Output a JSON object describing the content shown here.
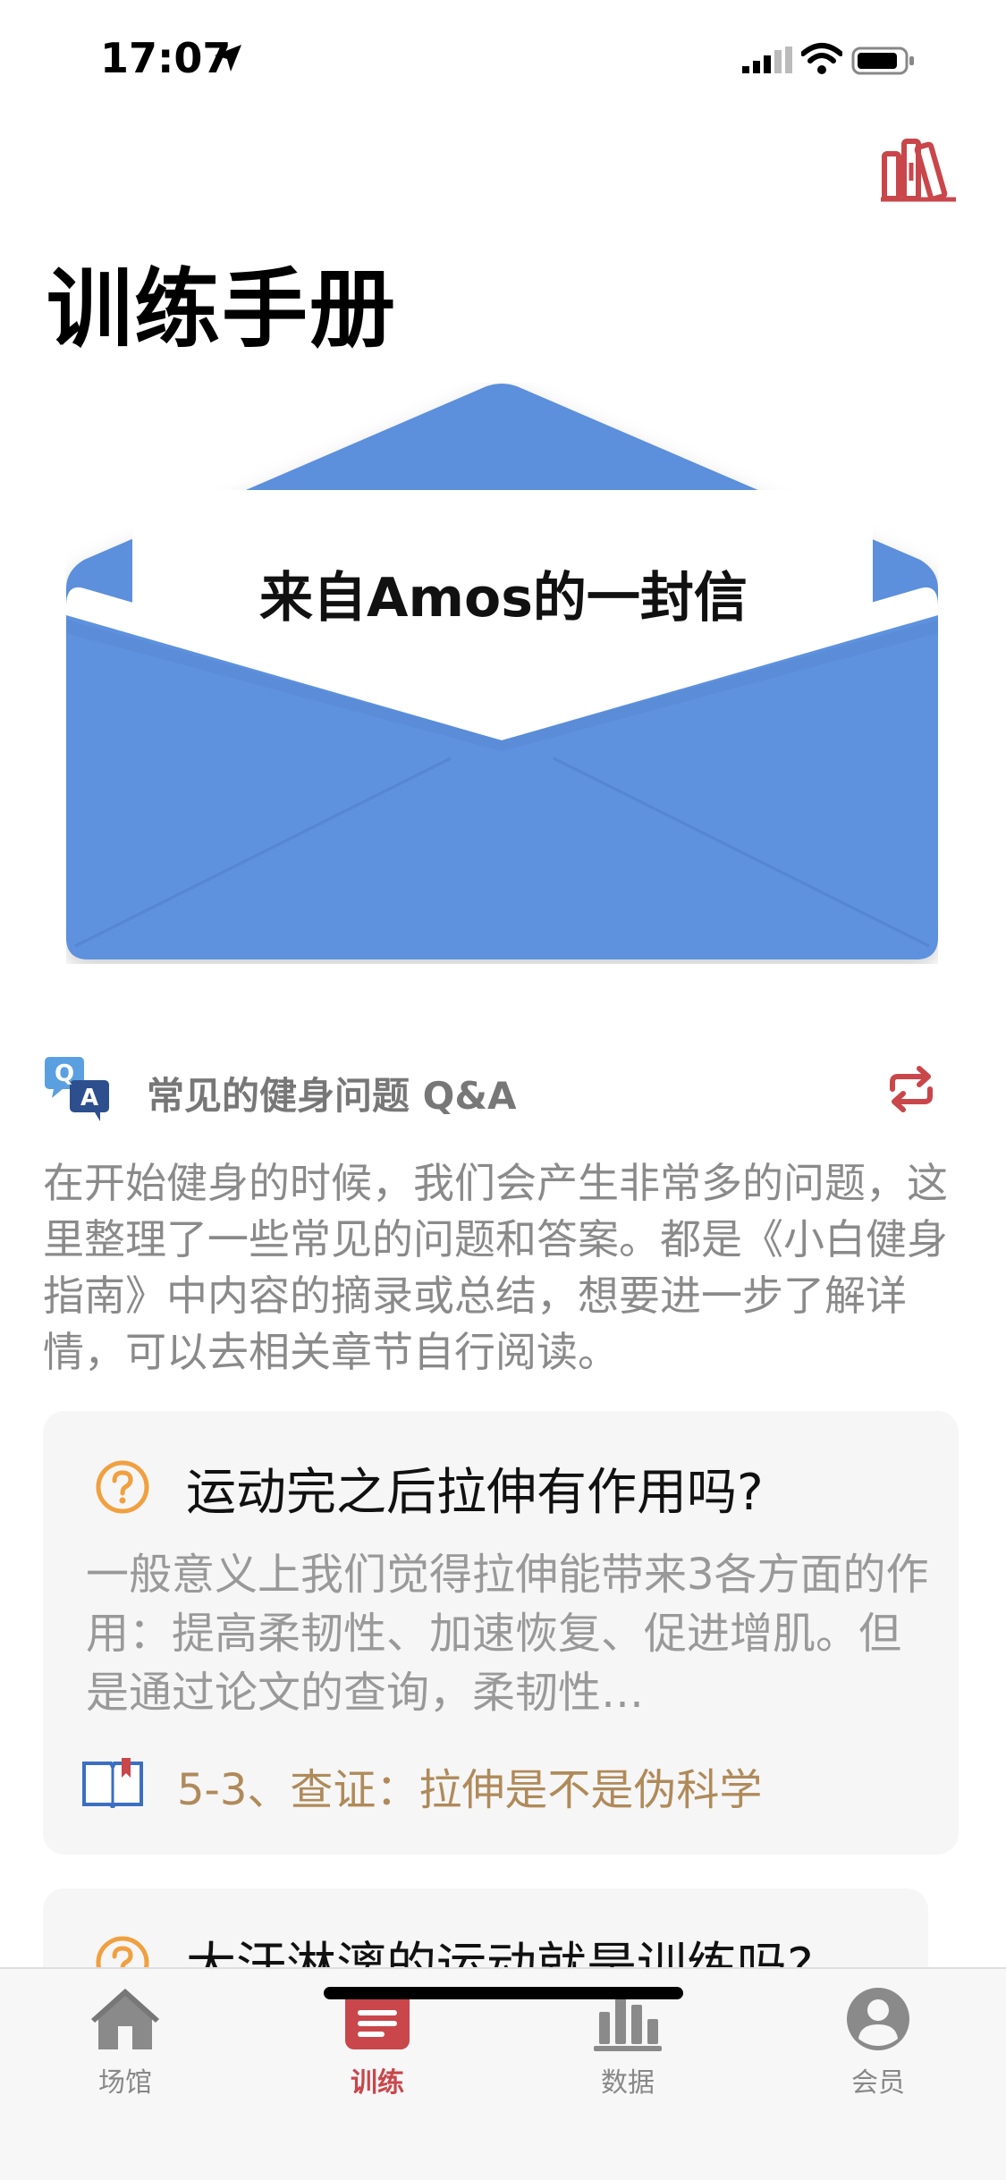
{
  "status_bar": {
    "time": "17:07"
  },
  "page": {
    "title": "训练手册"
  },
  "letter": {
    "title": "来自Amos的一封信"
  },
  "qa": {
    "icon_text_q": "Q",
    "icon_text_a": "A",
    "title": "常见的健身问题 Q&A",
    "description": "在开始健身的时候，我们会产生非常多的问题，这里整理了一些常见的问题和答案。都是《小白健身指南》中内容的摘录或总结，想要进一步了解详情，可以去相关章节自行阅读。"
  },
  "cards": [
    {
      "question": "运动完之后拉伸有作用吗?",
      "answer": "一般意义上我们觉得拉伸能带来3各方面的作用：提高柔韧性、加速恢复、促进增肌。但是通过论文的查询，柔韧性…",
      "link": "5-3、查证：拉伸是不是伪科学"
    },
    {
      "question": "大汗淋漓的运动就是训练吗?"
    }
  ],
  "tabs": [
    {
      "label": "场馆",
      "icon": "home-icon",
      "active": false
    },
    {
      "label": "训练",
      "icon": "notebook-icon",
      "active": true
    },
    {
      "label": "数据",
      "icon": "bar-chart-icon",
      "active": false
    },
    {
      "label": "会员",
      "icon": "person-icon",
      "active": false
    }
  ],
  "colors": {
    "accent": "#c9464b",
    "envelope": "#5b8fdc",
    "question_icon": "#f0a040",
    "link": "#b08a5a"
  }
}
